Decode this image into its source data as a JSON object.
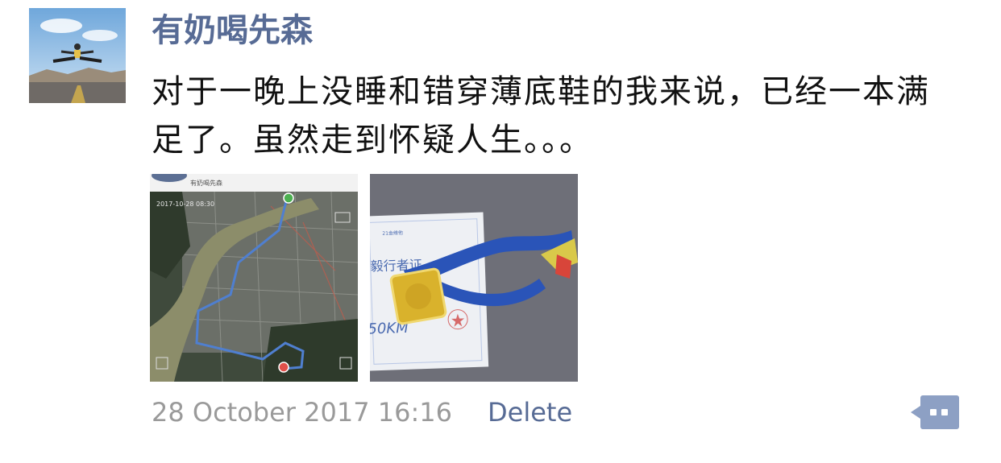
{
  "post": {
    "username": "有奶喝先森",
    "text": "对于一晚上没睡和错穿薄底鞋的我来说，已经一本满足了。虽然走到怀疑人生。。。",
    "timestamp": "28 October 2017 16:16",
    "delete_label": "Delete"
  },
  "images": {
    "map": {
      "header_name": "有奶喝先森",
      "date": "2017-10-28 08:30"
    },
    "medal": {
      "certificate_title": "毅行者证",
      "distance": "50KM",
      "sponsor": "21金维他"
    }
  },
  "icons": {
    "comment": "comment-bubble-icon"
  },
  "colors": {
    "username": "#576b95",
    "body_text": "#111111",
    "timestamp": "#9a9a9a",
    "link": "#576b95",
    "comment_button": "#8da0c4"
  }
}
